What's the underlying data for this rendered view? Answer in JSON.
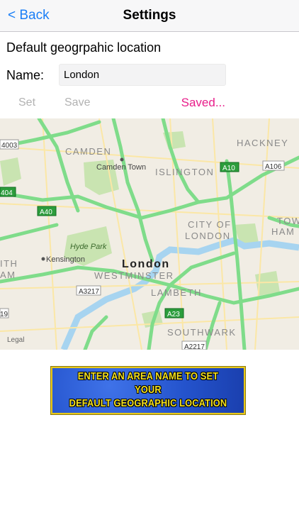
{
  "nav": {
    "back_label": "< Back",
    "title": "Settings"
  },
  "form": {
    "section_label": "Default geogrpahic location",
    "name_label": "Name:",
    "name_value": "London",
    "set_label": "Set",
    "save_label": "Save",
    "status_text": "Saved..."
  },
  "map": {
    "legal_label": "Legal",
    "areas": [
      "CAMDEN",
      "HACKNEY",
      "ISLINGTON",
      "CITY OF",
      "LONDON",
      "WESTMINSTER",
      "LAMBETH",
      "SOUTHWARK",
      "TOW",
      "HAM",
      "ITH",
      "AM"
    ],
    "places": [
      "Camden Town",
      "Hyde Park",
      "Kensington",
      "London"
    ],
    "roads": [
      "A10",
      "A106",
      "A40",
      "A3217",
      "A23",
      "A2217",
      "4003",
      "404",
      "19"
    ]
  },
  "banner": {
    "line1": "ENTER AN AREA NAME TO SET YOUR",
    "line2": "DEFAULT GEOGRAPHIC LOCATION"
  }
}
